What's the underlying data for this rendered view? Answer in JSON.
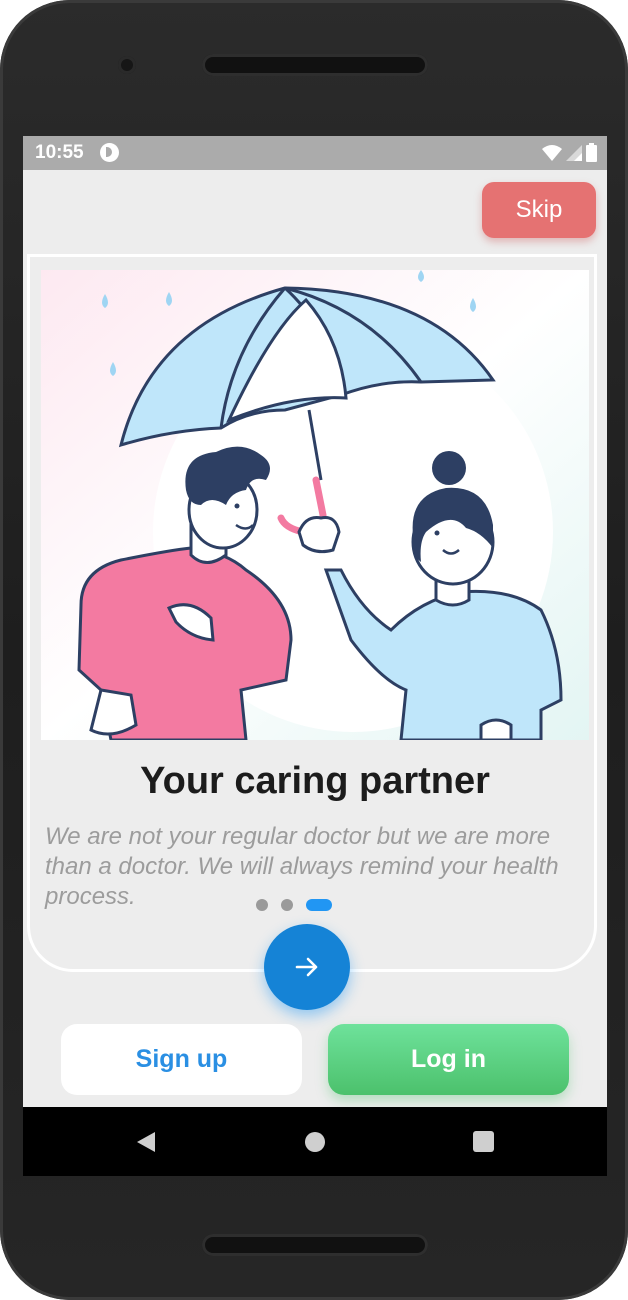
{
  "status_bar": {
    "time": "10:55",
    "icons": [
      "app-notification-icon",
      "wifi-icon",
      "signal-icon",
      "battery-icon"
    ]
  },
  "header": {
    "skip_label": "Skip"
  },
  "onboarding": {
    "illustration": "couple-under-umbrella-illustration",
    "title": "Your caring partner",
    "description": "We are not your regular doctor but we are more than a doctor. We will always remind your health process.",
    "page_indicator": {
      "total": 3,
      "active": 3
    },
    "next_icon": "arrow-right-icon"
  },
  "actions": {
    "signup_label": "Sign up",
    "login_label": "Log in"
  },
  "nav_bar": {
    "icons": [
      "back-icon",
      "home-icon",
      "recents-icon"
    ]
  },
  "colors": {
    "skip": "#e57272",
    "primary": "#1583d6",
    "signup_text": "#2a8fe3",
    "login_bg": "#4cc16c",
    "umbrella": "#bfe6fa",
    "man_shirt": "#f37aa1",
    "woman_shirt": "#bfe6fa"
  }
}
